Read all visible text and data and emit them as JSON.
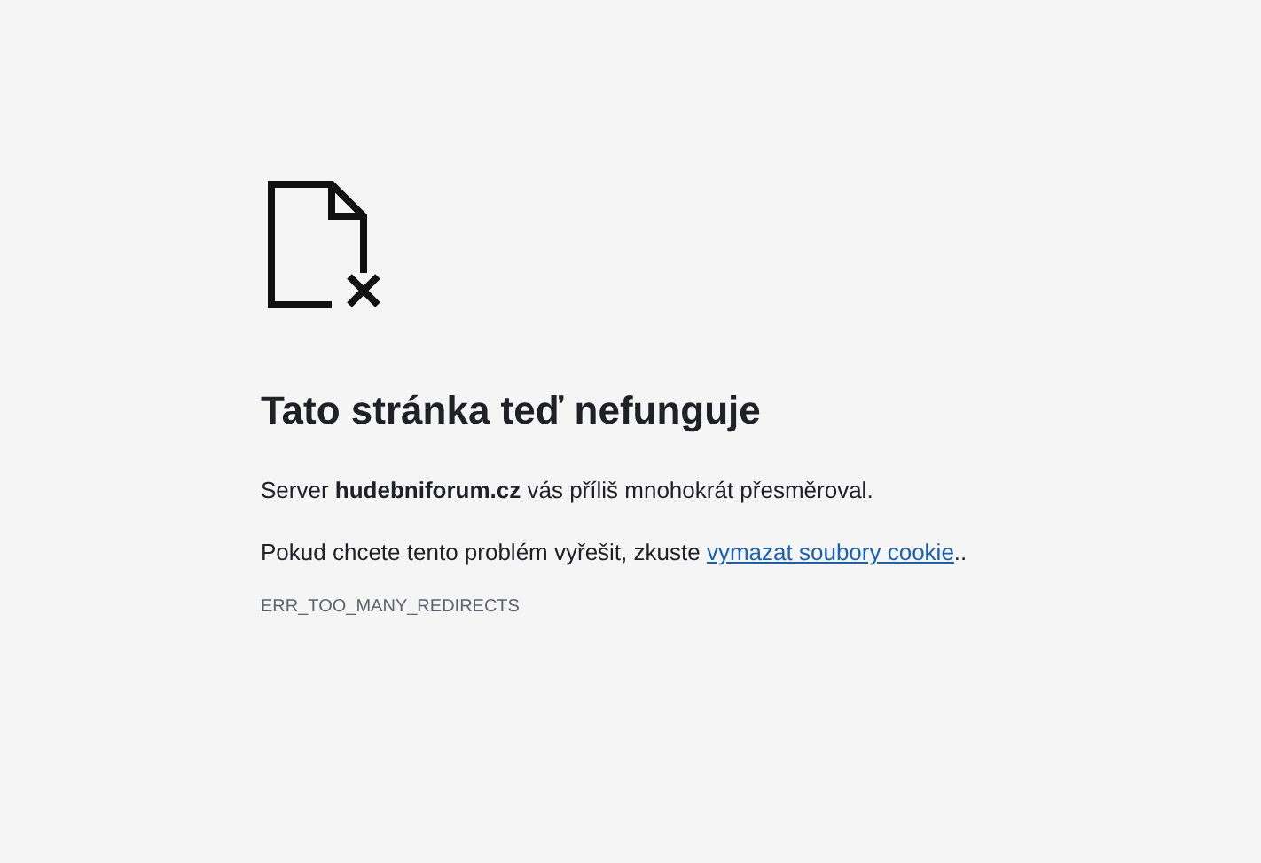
{
  "heading": "Tato stránka teď nefunguje",
  "message": "Server **hudebniforum.cz** vás příliš mnohokrát přesměroval.",
  "suggestion": {
    "before": "Pokud chcete tento problém vyřešit, zkuste ",
    "link": "vymazat soubory cookie",
    "after": ".."
  },
  "error_code": "ERR_TOO_MANY_REDIRECTS"
}
